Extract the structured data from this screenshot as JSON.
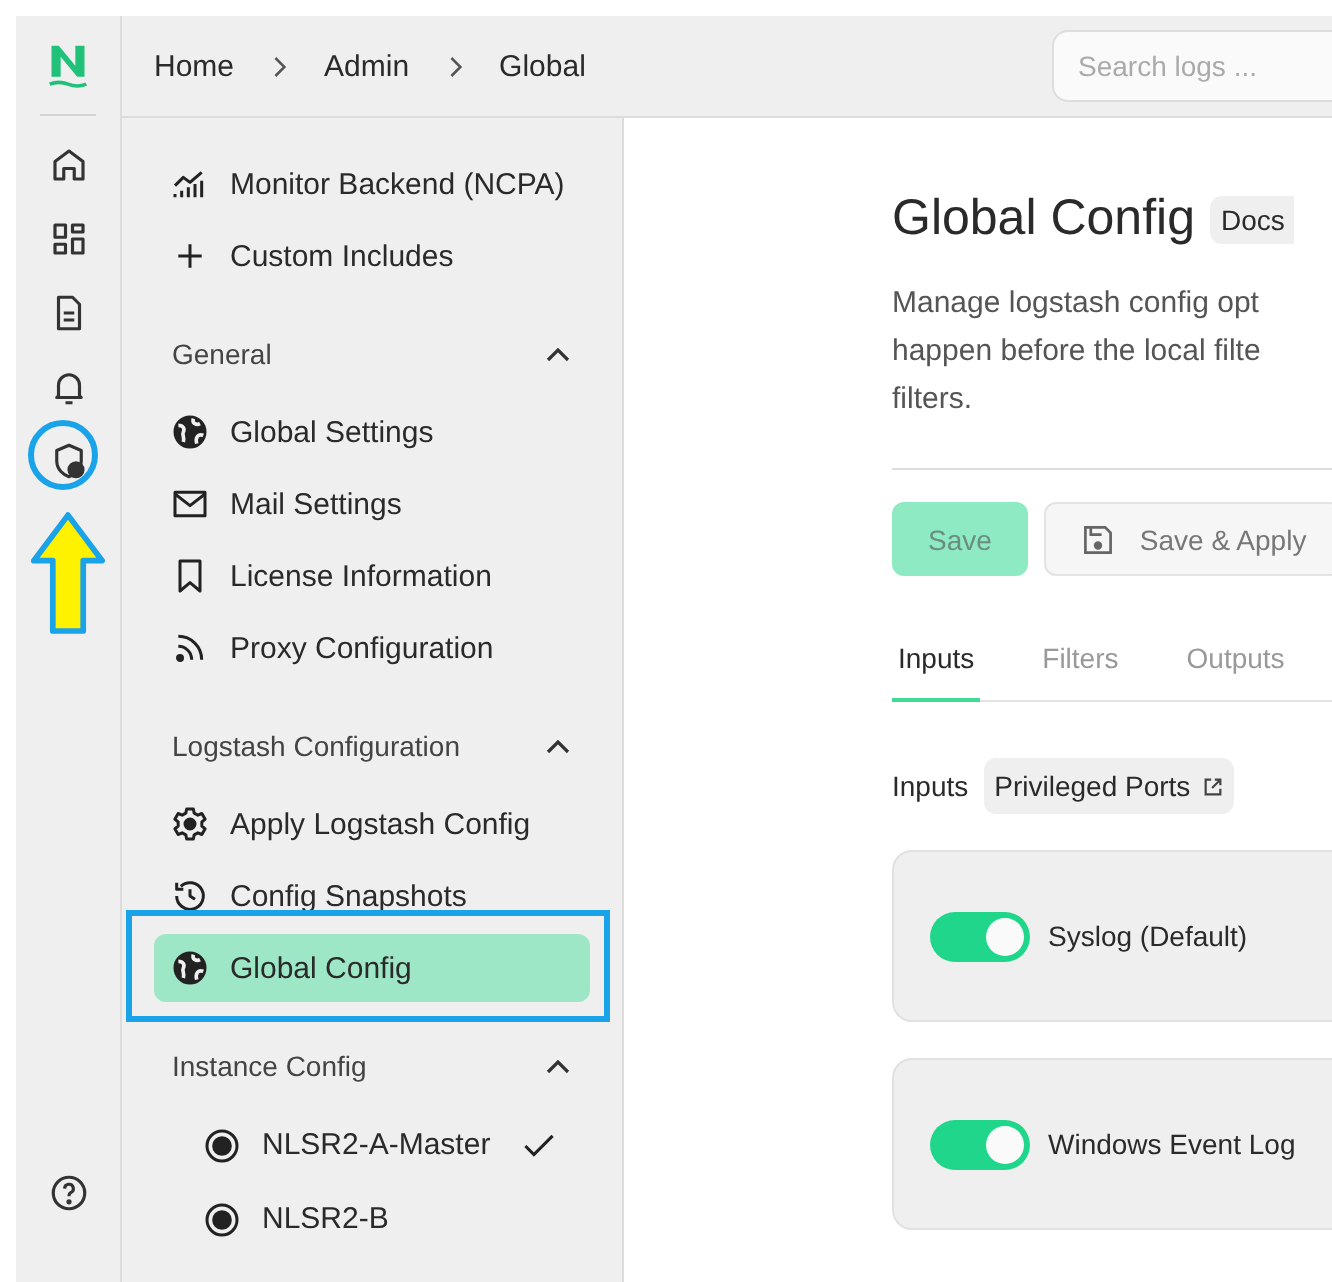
{
  "breadcrumb": [
    {
      "label": "Home"
    },
    {
      "label": "Admin"
    },
    {
      "label": "Global"
    }
  ],
  "search": {
    "placeholder": "Search logs ..."
  },
  "sidebar": {
    "groups": [
      {
        "items": [
          {
            "label": "Monitor Backend (NCPA)",
            "selected": false
          },
          {
            "label": "Custom Includes",
            "selected": false
          }
        ]
      },
      {
        "title": "General",
        "expanded": true,
        "items": [
          {
            "label": "Global Settings",
            "selected": false
          },
          {
            "label": "Mail Settings",
            "selected": false
          },
          {
            "label": "License Information",
            "selected": false
          },
          {
            "label": "Proxy Configuration",
            "selected": false
          }
        ]
      },
      {
        "title": "Logstash Configuration",
        "expanded": true,
        "items": [
          {
            "label": "Apply Logstash Config",
            "selected": false
          },
          {
            "label": "Config Snapshots",
            "selected": false
          },
          {
            "label": "Global Config",
            "selected": true
          }
        ]
      },
      {
        "title": "Instance Config",
        "expanded": true,
        "items": [
          {
            "label": "NLSR2-A-Master",
            "checked": true
          },
          {
            "label": "NLSR2-B",
            "checked": false
          }
        ]
      }
    ]
  },
  "page": {
    "title": "Global Config",
    "badge": "Docs",
    "description": [
      "Manage logstash config opt",
      "happen before the local filte",
      "filters."
    ],
    "buttons": [
      {
        "label": "Save",
        "kind": "primary",
        "disabled": true
      },
      {
        "label": "Save & Apply",
        "kind": "secondary",
        "disabled": true
      }
    ],
    "tabs": [
      {
        "label": "Inputs",
        "selected": true
      },
      {
        "label": "Filters",
        "selected": false
      },
      {
        "label": "Outputs",
        "selected": false
      }
    ],
    "section": {
      "label": "Inputs",
      "link": "Privileged Ports"
    },
    "inputs": [
      {
        "name": "Syslog (Default)",
        "on": true
      },
      {
        "name": "Windows Event Log",
        "on": true
      }
    ]
  }
}
